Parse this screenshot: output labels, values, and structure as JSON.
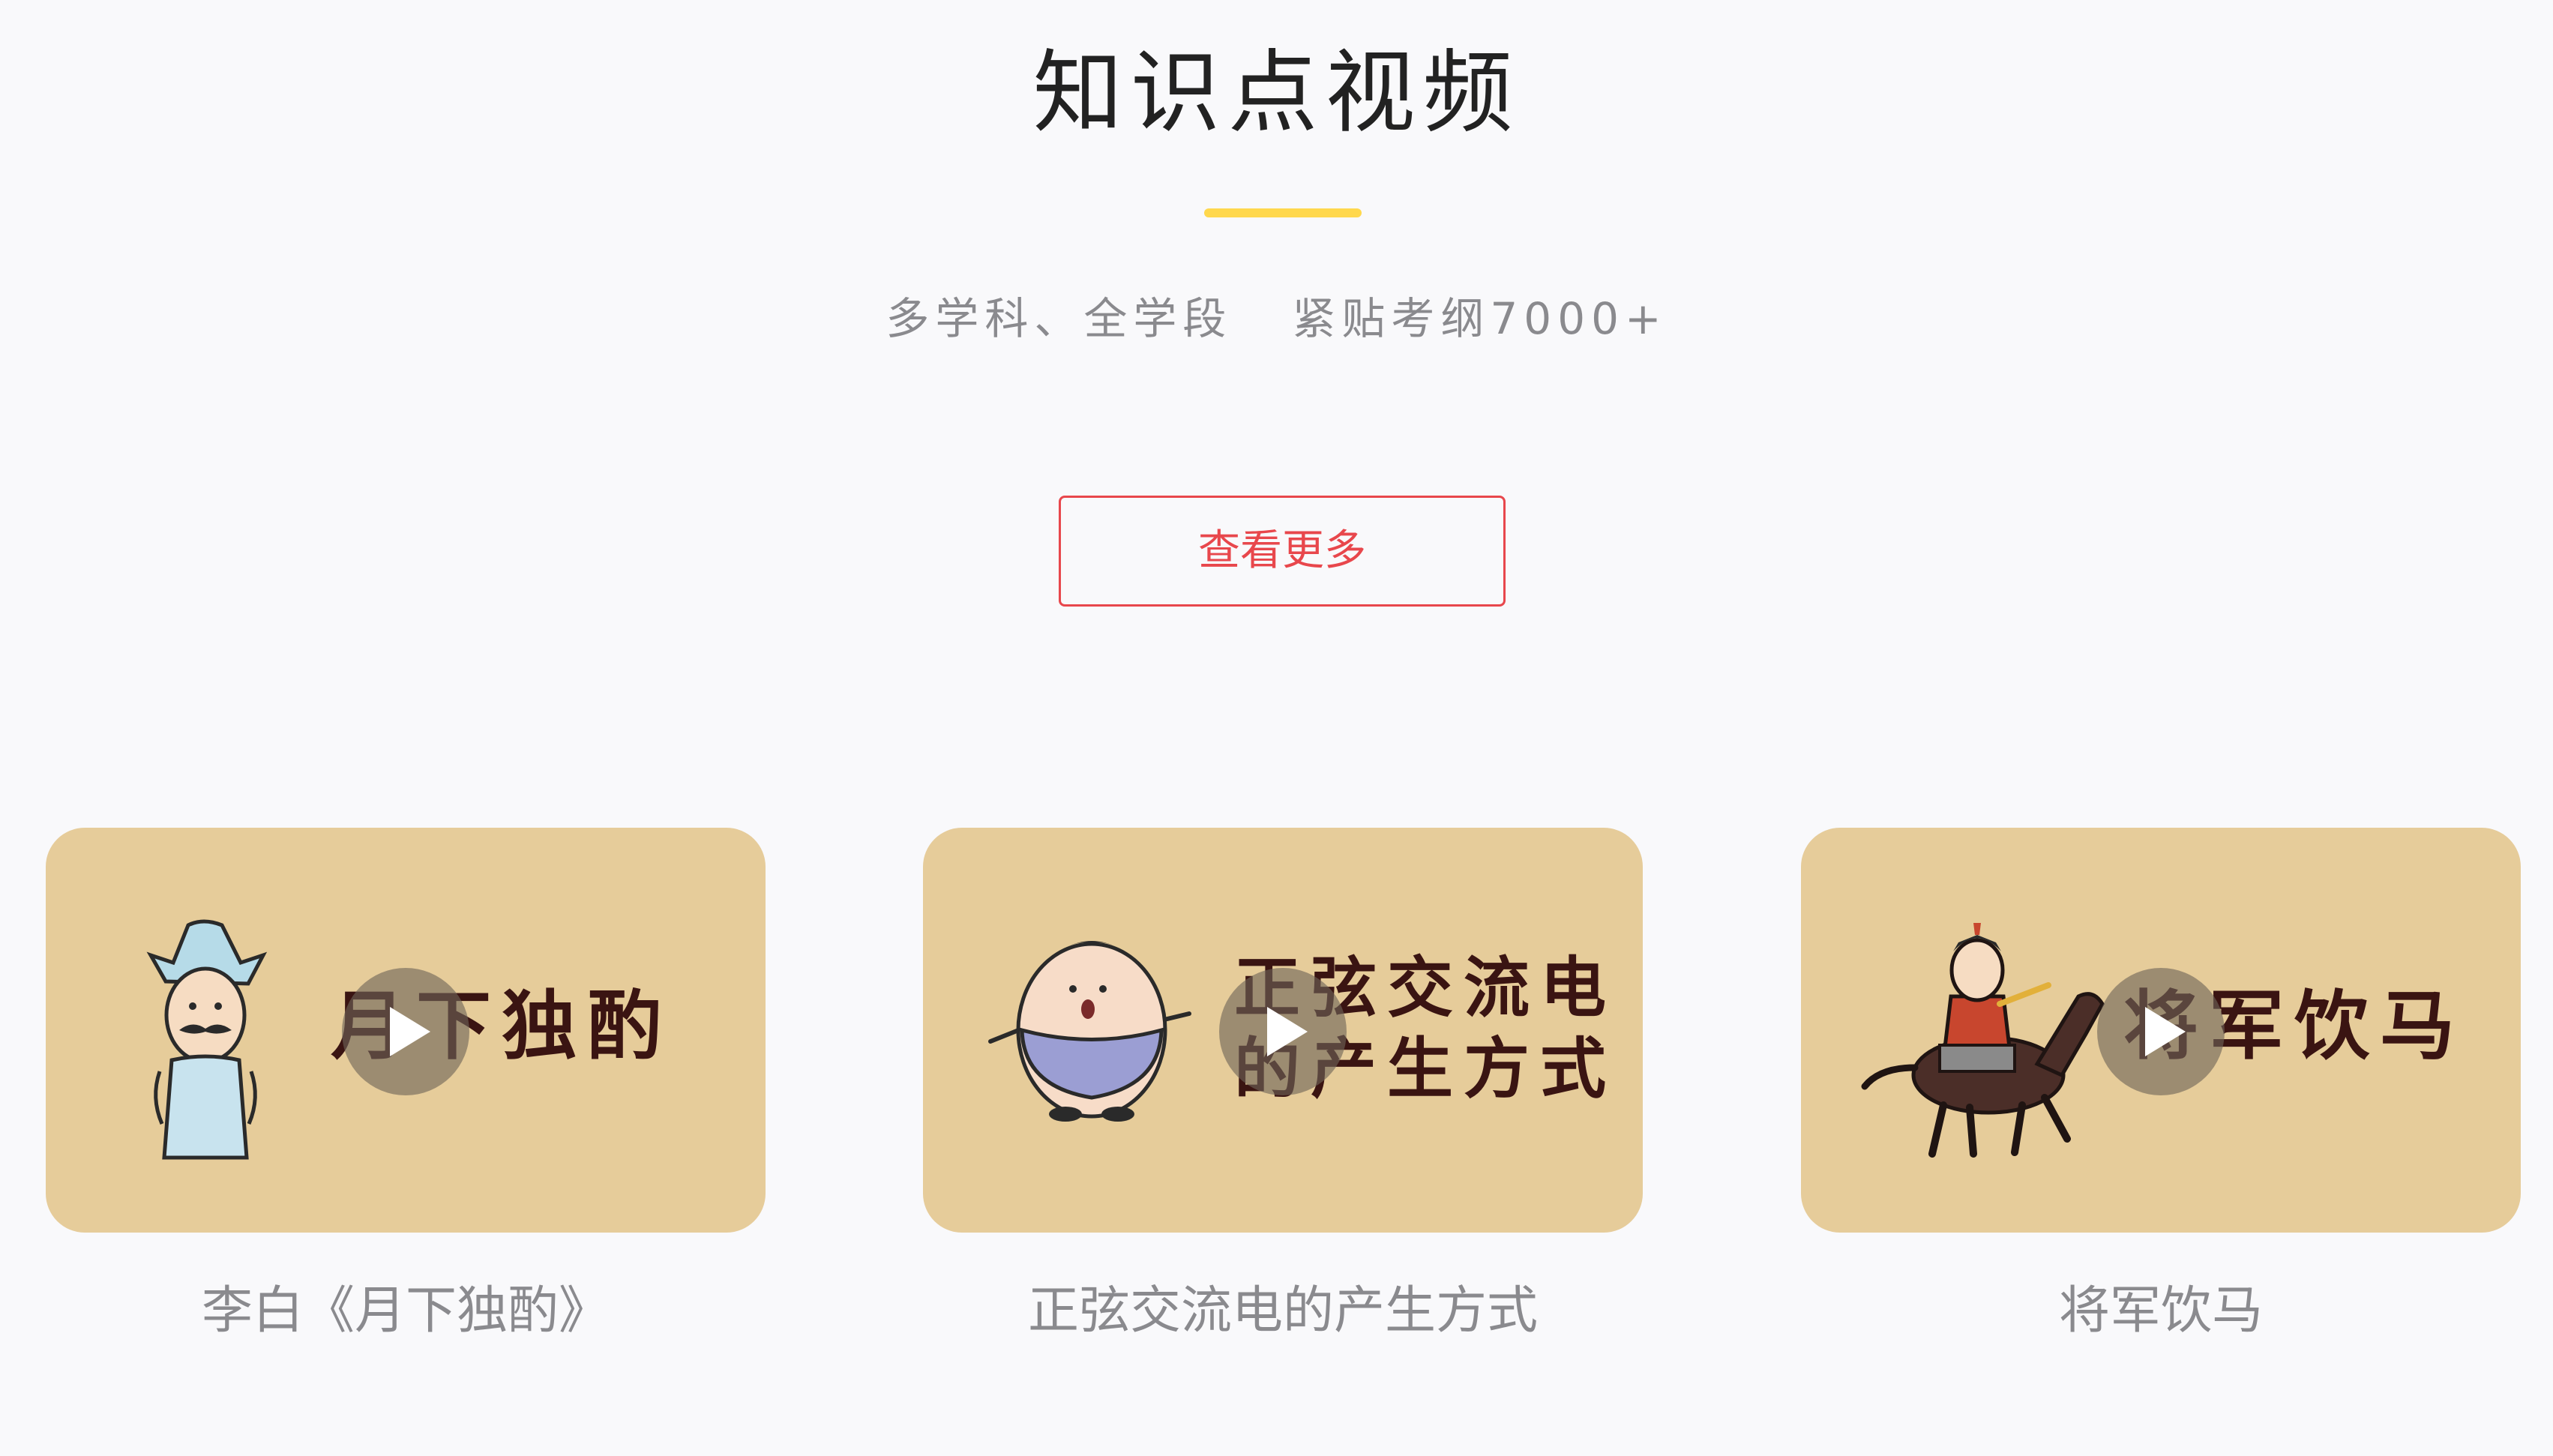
{
  "section": {
    "title": "知识点视频",
    "subtitle_left": "多学科、全学段",
    "subtitle_right": "紧贴考纲7000+",
    "more_button_label": "查看更多"
  },
  "colors": {
    "accent_yellow": "#ffd84d",
    "button_red": "#e8474c",
    "thumb_bg": "#e6cc9a",
    "thumb_text": "#3a1412",
    "caption_gray": "#8a8a8e"
  },
  "videos": [
    {
      "thumb_text": "月下独酌",
      "caption": "李白《月下独酌》",
      "illustration": "li-bai-figure-icon"
    },
    {
      "thumb_text_line1": "正弦交流电",
      "thumb_text_line2": "的产生方式",
      "caption": "正弦交流电的产生方式",
      "illustration": "egg-character-icon"
    },
    {
      "thumb_text": "将军饮马",
      "caption": "将军饮马",
      "illustration": "general-on-horse-icon"
    }
  ]
}
